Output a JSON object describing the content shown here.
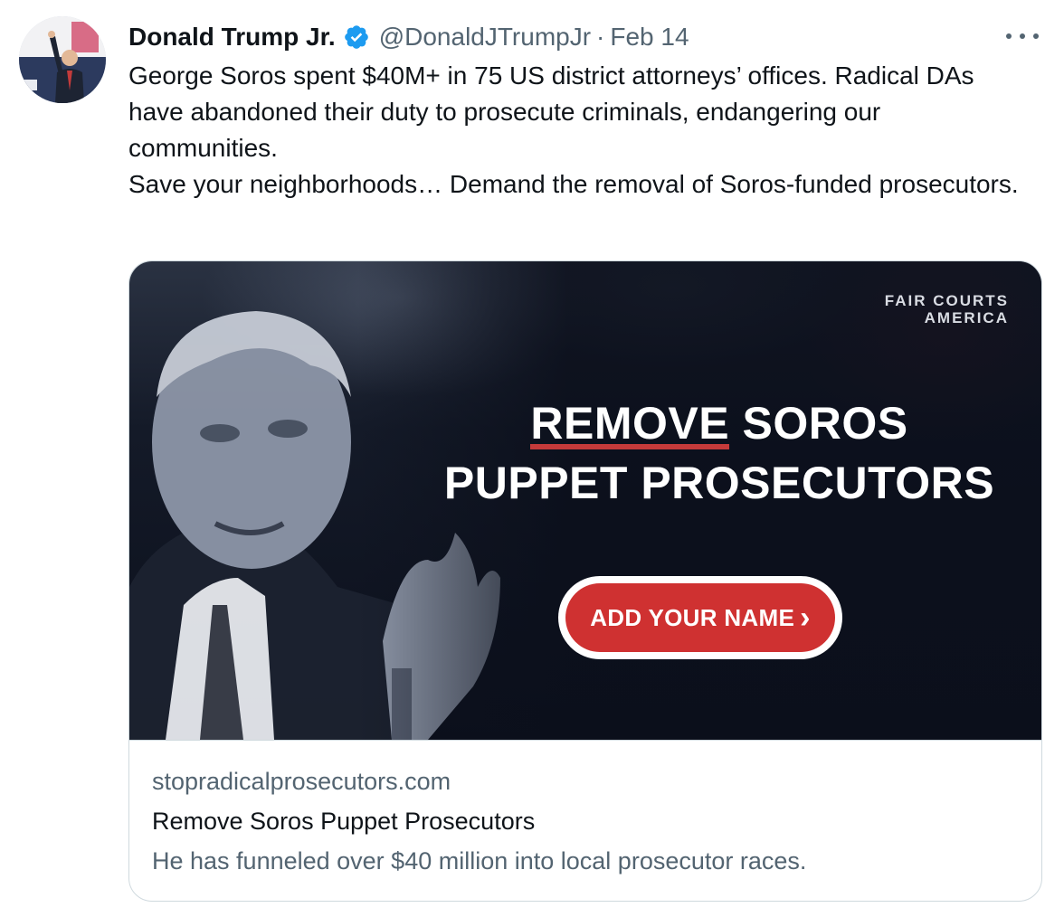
{
  "tweet": {
    "author_name": "Donald Trump Jr.",
    "author_handle": "@DonaldJTrumpJr",
    "separator": "·",
    "date": "Feb 14",
    "verified_icon": "verified-badge-icon",
    "more_icon": "more-options-icon",
    "text_lines": [
      "George Soros spent $40M+ in 75 US district attorneys’ offices. Radical DAs have abandoned their duty to prosecute criminals, endangering our communities.",
      "Save your neighborhoods… Demand the removal of Soros-funded prosecutors."
    ]
  },
  "card": {
    "media": {
      "brand_line1": "FAIR COURTS",
      "brand_line2": "AMERICA",
      "headline_underlined": "REMOVE",
      "headline_rest": " SOROS",
      "headline_line2": "PUPPET PROSECUTORS",
      "cta_label": "ADD YOUR NAME",
      "cta_icon": "chevron-right-icon"
    },
    "domain": "stopradicalprosecutors.com",
    "title": "Remove Soros Puppet Prosecutors",
    "description": "He has funneled over $40 million into local prosecutor races."
  },
  "colors": {
    "text_primary": "#0f1419",
    "text_secondary": "#536471",
    "verified_blue": "#1d9bf0",
    "cta_red": "#cf3131",
    "card_border": "#cfd9de"
  }
}
